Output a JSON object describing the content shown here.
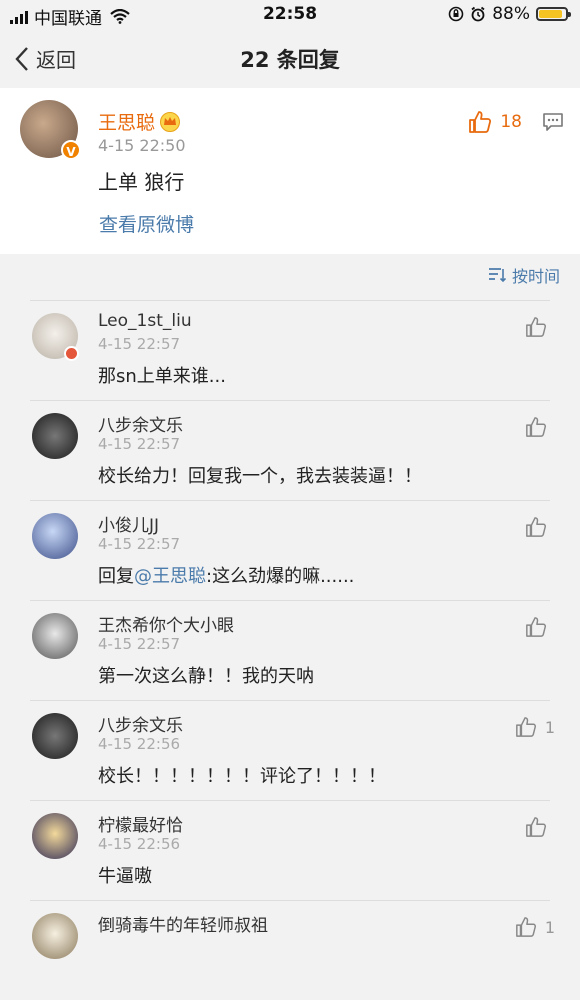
{
  "status": {
    "carrier": "中国联通",
    "time": "22:58",
    "battery": "88%",
    "battery_level": 0.88
  },
  "nav": {
    "back_label": "返回",
    "title": "22 条回复"
  },
  "original": {
    "name": "王思聪",
    "time": "4-15 22:50",
    "text": "上单 狼行",
    "link": "查看原微博",
    "likes": "18",
    "name_color": "#e86b0f"
  },
  "sort": {
    "label": "按时间"
  },
  "comments": [
    {
      "name": "Leo_1st_liu",
      "time": "4-15 22:57",
      "text": "那sn上单来谁...",
      "likes": ""
    },
    {
      "name": "八步余文乐",
      "time": "4-15 22:57",
      "text": "校长给力！回复我一个，我去装装逼！！",
      "likes": ""
    },
    {
      "name": "小俊儿JJ",
      "time": "4-15 22:57",
      "text_prefix": "回复",
      "mention": "@王思聪",
      "text": ":这么劲爆的嘛......",
      "likes": ""
    },
    {
      "name": "王杰希你个大小眼",
      "time": "4-15 22:57",
      "text": "第一次这么静！！我的天呐",
      "likes": ""
    },
    {
      "name": "八步余文乐",
      "time": "4-15 22:56",
      "text": "校长！！！！！！！评论了！！！！",
      "likes": "1"
    },
    {
      "name": "柠檬最好恰",
      "time": "4-15 22:56",
      "text": "牛逼嗷",
      "likes": ""
    },
    {
      "name": "倒骑毒牛的年轻师叔祖",
      "time": "",
      "text": "",
      "likes": "1"
    }
  ],
  "colors": {
    "link": "#4b7bab",
    "accent": "#e86b0f",
    "background": "#f2f2f2"
  }
}
